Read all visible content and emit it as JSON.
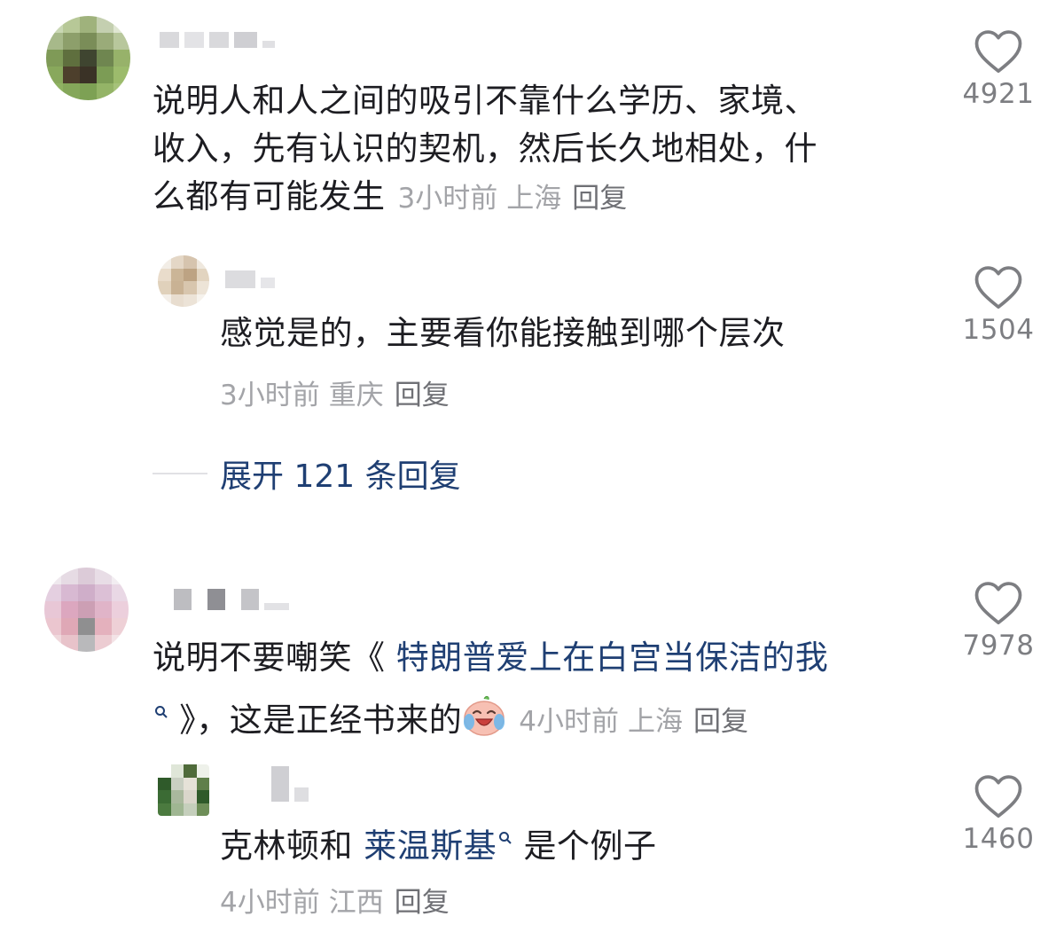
{
  "comments": [
    {
      "text": "说明人和人之间的吸引不靠什么学历、家境、收入，先有认识的契机，然后长久地相处，什么都有可能发生",
      "line1": "说明人和人之间的吸引不靠什么学历、家境、",
      "line2": "收入，先有认识的契机，然后长久地相处，什",
      "line3": "么都有可能发生",
      "time": "3小时前",
      "location": "上海",
      "reply_label": "回复",
      "likes": "4921",
      "reply": {
        "text": "感觉是的，主要看你能接触到哪个层次",
        "time": "3小时前",
        "location": "重庆",
        "reply_label": "回复",
        "likes": "1504"
      },
      "expand_label": "展开 121 条回复"
    },
    {
      "text_prefix": "说明不要嘲笑《",
      "link_text": " 特朗普爱上在白宫当保洁的我",
      "text_suffix": " 》，这是正经书来的",
      "emoji": "crying-laughing-emoji",
      "time": "4小时前",
      "location": "上海",
      "reply_label": "回复",
      "likes": "7978",
      "reply": {
        "text_prefix": "克林顿和 ",
        "link_text": "莱温斯基",
        "text_suffix": " 是个例子",
        "time": "4小时前",
        "location": "江西",
        "reply_label": "回复",
        "likes": "1460"
      }
    }
  ],
  "colors": {
    "text": "#1d1d22",
    "meta": "#a3a4a8",
    "link": "#1f3f73",
    "like_icon": "#7d7e82"
  },
  "icons": [
    "heart-outline-icon",
    "search-icon",
    "crying-laughing-emoji"
  ]
}
